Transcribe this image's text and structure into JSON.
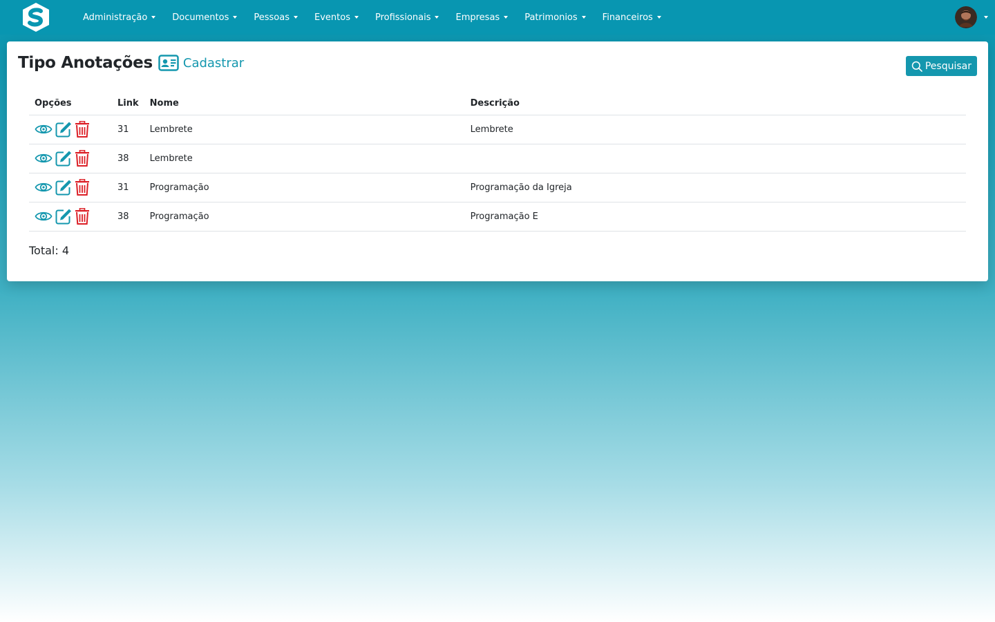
{
  "nav": {
    "items": [
      {
        "label": "Administração"
      },
      {
        "label": "Documentos"
      },
      {
        "label": "Pessoas"
      },
      {
        "label": "Eventos"
      },
      {
        "label": "Profissionais"
      },
      {
        "label": "Empresas"
      },
      {
        "label": "Patrimonios"
      },
      {
        "label": "Financeiros"
      }
    ]
  },
  "page": {
    "title": "Tipo Anotações",
    "create_label": "Cadastrar",
    "search_label": "Pesquisar"
  },
  "table": {
    "headers": {
      "options": "Opções",
      "link": "Link",
      "nome": "Nome",
      "descricao": "Descrição"
    },
    "rows": [
      {
        "link": "31",
        "nome": "Lembrete",
        "descricao": "Lembrete"
      },
      {
        "link": "38",
        "nome": "Lembrete",
        "descricao": ""
      },
      {
        "link": "31",
        "nome": "Programação",
        "descricao": "Programação da Igreja"
      },
      {
        "link": "38",
        "nome": "Programação",
        "descricao": "Programação E"
      }
    ]
  },
  "footer": {
    "total_label": "Total: 4"
  },
  "colors": {
    "navbar": "#0896b1",
    "accent": "#1497ae",
    "delete": "#dc1f26"
  },
  "icons": {
    "view": "eye-icon",
    "edit": "edit-icon",
    "delete": "trash-icon",
    "create": "id-card-icon",
    "search": "search-icon"
  }
}
